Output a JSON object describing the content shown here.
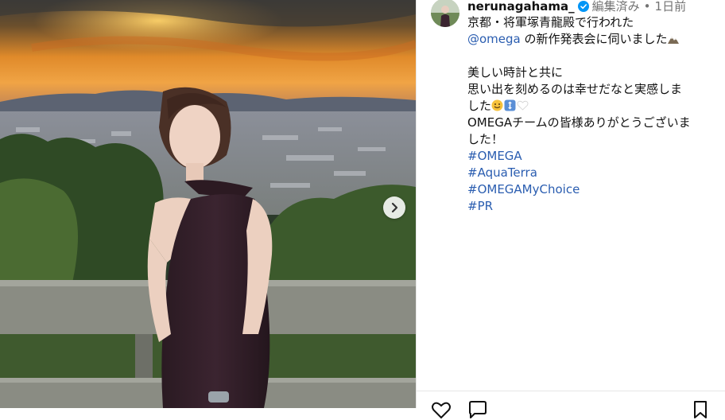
{
  "post": {
    "username": "nerunagahama_",
    "edited_label": "編集済み",
    "separator": "•",
    "time": "1日前"
  },
  "caption": {
    "line1": "京都・将軍塚青龍殿で行われた",
    "mention": "@omega",
    "line2_rest": " の新作発表会に伺いました",
    "line3": "美しい時計と共に",
    "line4": "思い出を刻めるのは幸せだなと実感しま",
    "line5": "した",
    "line6": "OMEGAチームの皆様ありがとうございま",
    "line7": "した！",
    "hashtags": [
      "#OMEGA",
      "#AquaTerra",
      "#OMEGAMyChoice",
      "#PR"
    ]
  },
  "icons": {
    "verified": "verified-badge-icon",
    "next": "chevron-right-icon",
    "mountain_emoji": "mountain-emoji-icon",
    "smile_emoji": "smiling-face-emoji-icon",
    "arrows_emoji": "up-down-arrow-emoji-icon",
    "heart_emoji": "white-heart-emoji-icon",
    "like": "heart-icon",
    "comment": "comment-icon",
    "bookmark": "bookmark-icon"
  },
  "colors": {
    "link": "#2a5db0",
    "verified": "#0095f6",
    "muted": "#737373"
  }
}
